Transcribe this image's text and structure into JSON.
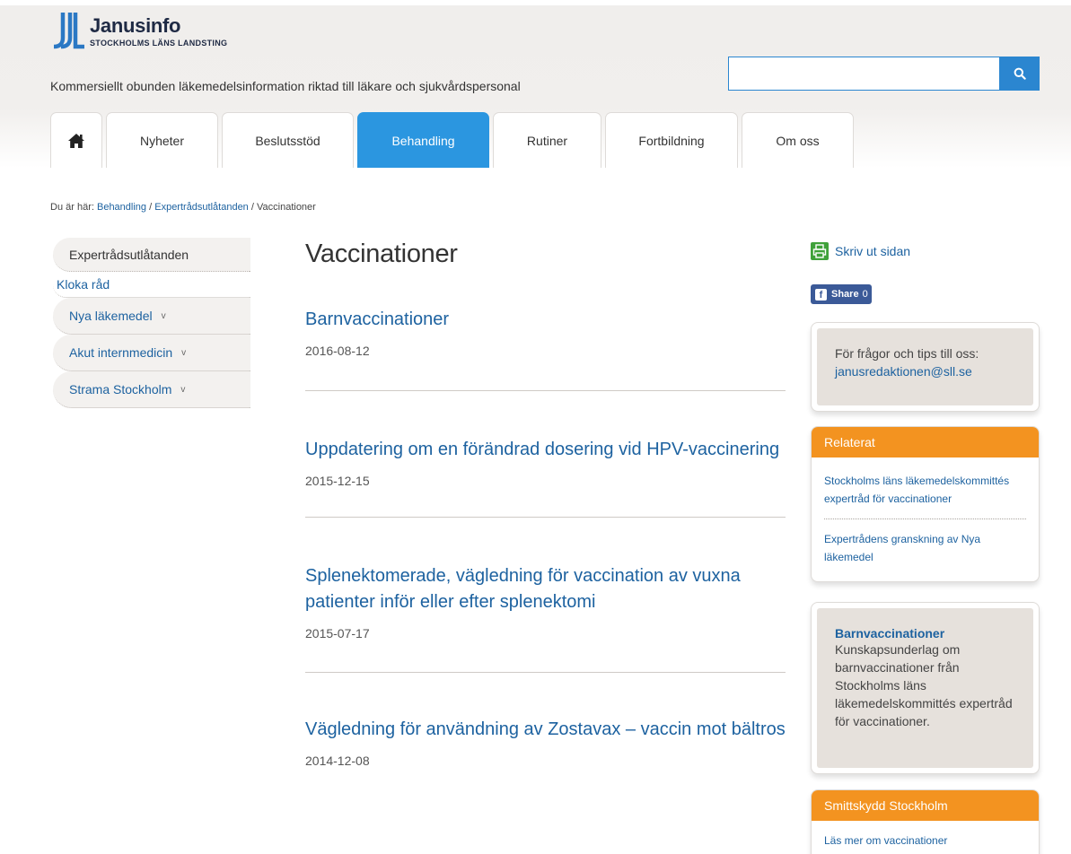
{
  "header": {
    "logo_name": "Janusinfo",
    "logo_sub": "STOCKHOLMS LÄNS LANDSTING",
    "tagline": "Kommersiellt obunden läkemedelsinformation riktad till läkare och sjukvårdspersonal",
    "search": {
      "value": "",
      "placeholder": "",
      "button_icon": "search-icon"
    }
  },
  "nav": {
    "home_icon": "home-icon",
    "tabs": [
      {
        "label": "Nyheter"
      },
      {
        "label": "Beslutsstöd"
      },
      {
        "label": "Behandling",
        "active": true
      },
      {
        "label": "Rutiner"
      },
      {
        "label": "Fortbildning"
      },
      {
        "label": "Om oss"
      }
    ]
  },
  "breadcrumb": {
    "prefix": "Du är här:",
    "items": [
      "Behandling",
      "Expertrådsutlåtanden",
      "Vaccinationer"
    ],
    "separator": "/"
  },
  "leftmenu": {
    "items": [
      {
        "label": "Expertrådsutlåtanden"
      },
      {
        "label": "Kloka råd"
      },
      {
        "label": "Nya läkemedel",
        "chevron": "v"
      },
      {
        "label": "Akut internmedicin",
        "chevron": "v"
      },
      {
        "label": "Strama Stockholm",
        "chevron": "v"
      }
    ]
  },
  "main": {
    "title": "Vaccinationer",
    "articles": [
      {
        "title": "Barnvaccinationer",
        "date": "2016-08-12"
      },
      {
        "title": "Uppdatering om en förändrad dosering vid HPV-vaccinering",
        "date": "2015-12-15"
      },
      {
        "title": "Splenektomerade, vägledning för vaccination av vuxna patienter inför eller efter splenektomi",
        "date": "2015-07-17"
      },
      {
        "title": "Vägledning för användning av Zostavax – vaccin mot bältros",
        "date": "2014-12-08"
      }
    ]
  },
  "sidebar": {
    "print_label": "Skriv ut sidan",
    "share_label": "Share",
    "share_count": "0",
    "contact_text": "För frågor och tips till oss:",
    "contact_email": "janusredaktionen@sll.se",
    "related": {
      "header": "Relaterat",
      "links": [
        "Stockholms läns läkemedelskommittés expertråd för vaccinationer",
        "Expertrådens granskning av Nya läkemedel"
      ]
    },
    "promo": {
      "title": "Barnvaccinationer",
      "text": "Kunskapsunderlag om barnvaccinationer från Stockholms läns läkemedelskommittés expertråd för vaccinationer."
    },
    "smittskydd": {
      "header": "Smittskydd Stockholm",
      "link": "Läs mer om vaccinationer"
    }
  },
  "colors": {
    "primary_blue": "#2b96e0",
    "link_blue": "#1d62a0",
    "orange": "#f39320",
    "beige": "#e6e1dc"
  }
}
